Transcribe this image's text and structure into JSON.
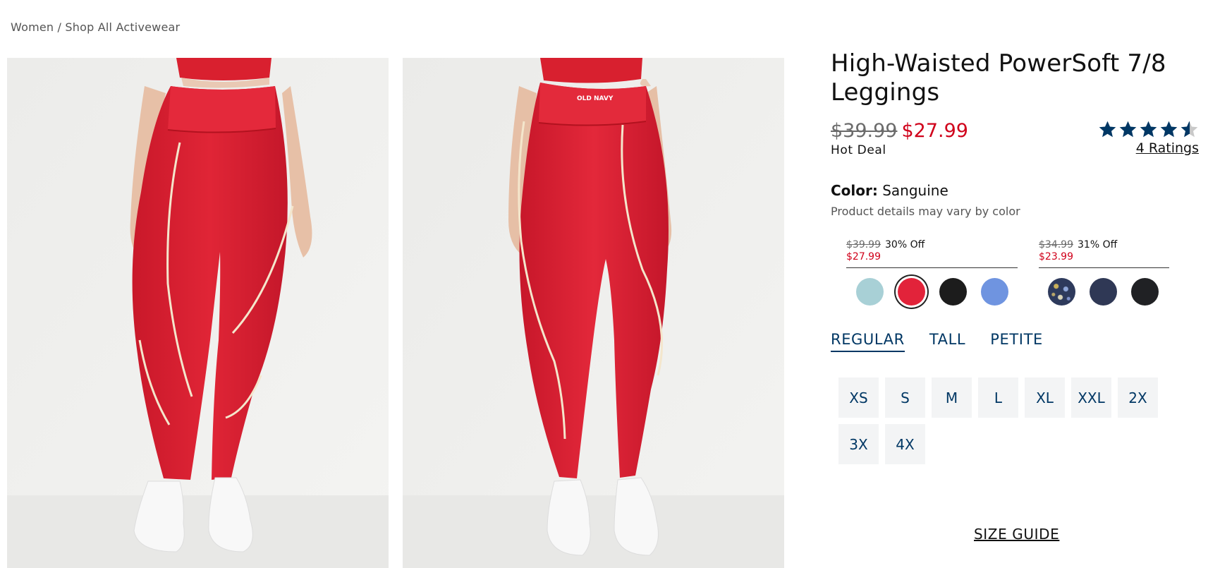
{
  "breadcrumb": {
    "parent": "Women",
    "separator": " / ",
    "current": "Shop All Activewear"
  },
  "gallery": [
    {
      "alt": "front view"
    },
    {
      "alt": "back view"
    }
  ],
  "product": {
    "title": "High-Waisted PowerSoft 7/8 Leggings",
    "price_was": "$39.99",
    "price_now": "$27.99",
    "deal_label": "Hot Deal",
    "rating_value": 4.5,
    "rating_max": 5,
    "ratings_link": "4 Ratings"
  },
  "color": {
    "label": "Color:",
    "value": "Sanguine",
    "note": "Product details may vary by color"
  },
  "swatch_groups": [
    {
      "was": "$39.99",
      "off": "30% Off",
      "now": "$27.99",
      "swatches": [
        {
          "color": "#a8d0d6"
        },
        {
          "color": "#e2233a",
          "selected": true
        },
        {
          "color": "#1c1c1c"
        },
        {
          "color": "#6f94e0"
        }
      ]
    },
    {
      "was": "$34.99",
      "off": "31% Off",
      "now": "$23.99",
      "swatches": [
        {
          "color": "#2e3a5c",
          "pattern": "floral"
        },
        {
          "color": "#2f3855"
        },
        {
          "color": "#202124"
        }
      ]
    }
  ],
  "fit_tabs": [
    {
      "label": "REGULAR",
      "active": true
    },
    {
      "label": "TALL"
    },
    {
      "label": "PETITE"
    }
  ],
  "sizes": [
    "XS",
    "S",
    "M",
    "L",
    "XL",
    "XXL",
    "2X",
    "3X",
    "4X"
  ],
  "size_guide": "SIZE GUIDE",
  "colors": {
    "sale_red": "#d0021b",
    "navy": "#003764",
    "star": "#003764"
  }
}
